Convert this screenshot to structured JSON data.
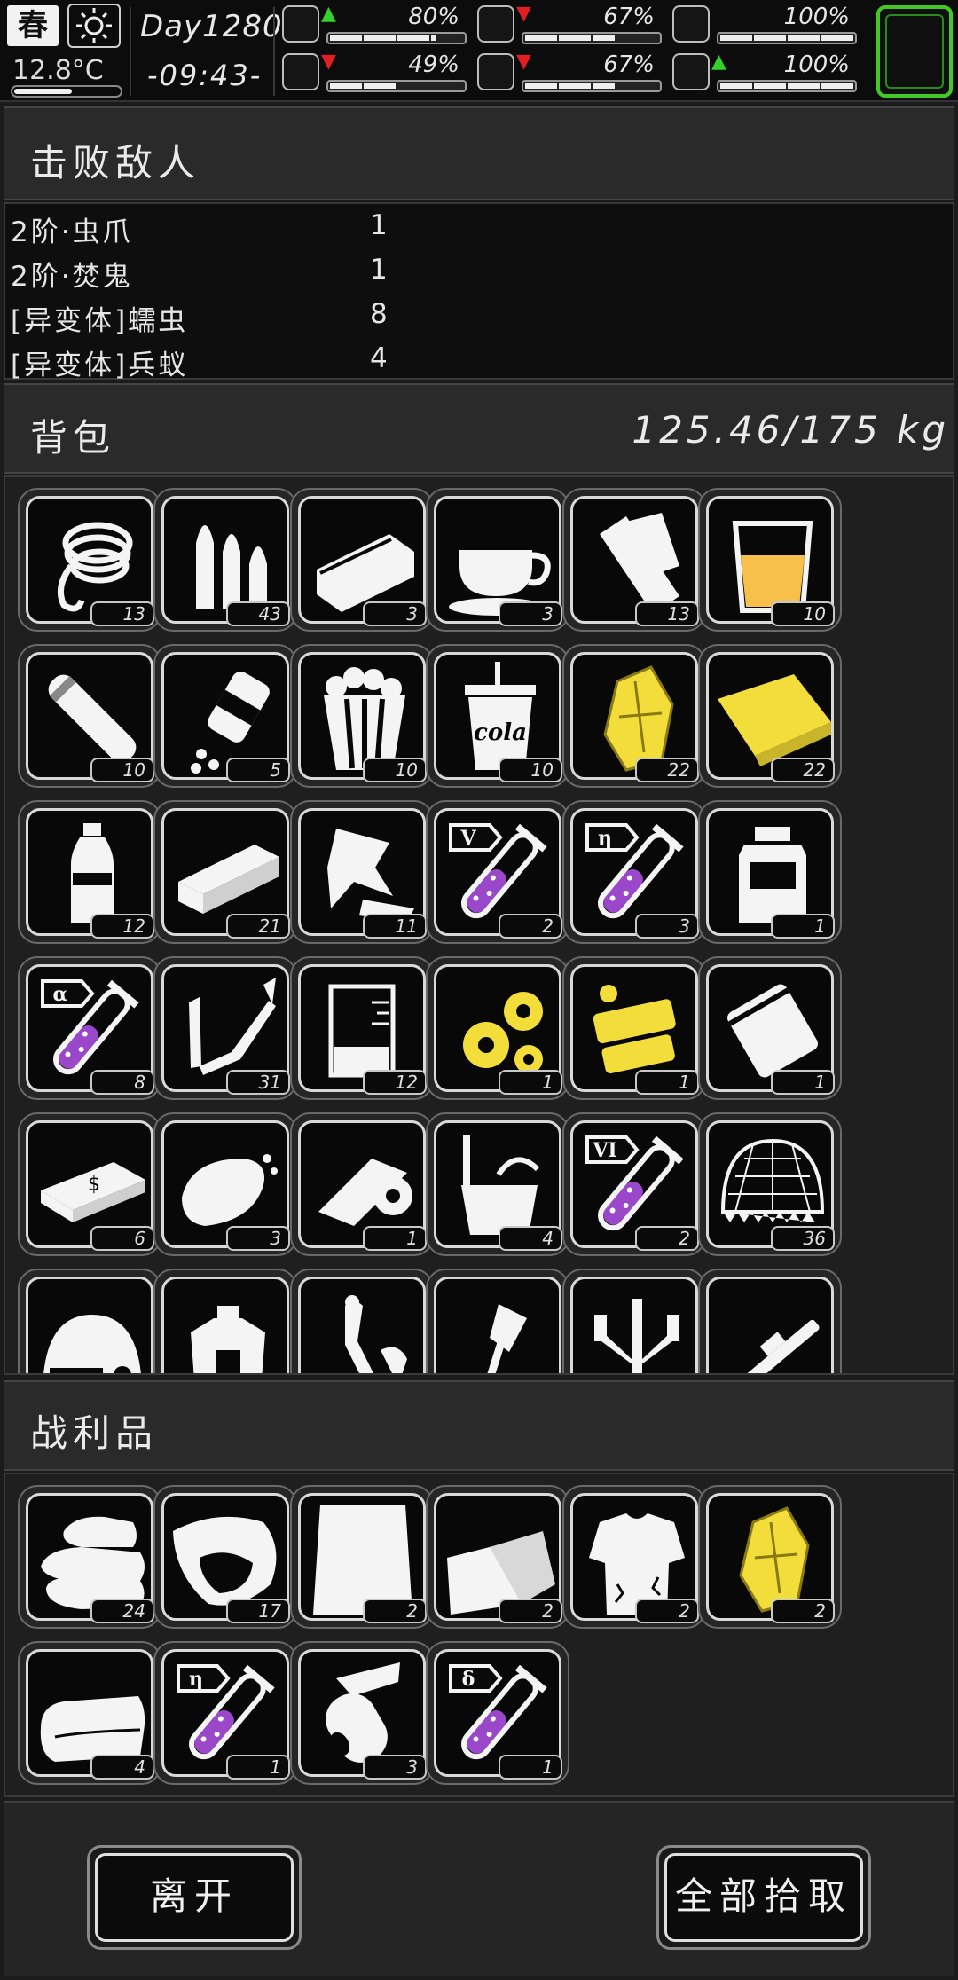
{
  "hud": {
    "season": "春",
    "weather_icon": "sun-icon",
    "temperature": "12.8°C",
    "temperature_level": 0.55,
    "day": "Day1280",
    "time": "-09:43-",
    "stats": [
      {
        "id": "health",
        "icon": "medkit-icon",
        "trend": "up",
        "value": "80%",
        "level": 0.8
      },
      {
        "id": "hunger",
        "icon": "stomach-icon",
        "trend": "down",
        "value": "67%",
        "level": 0.67
      },
      {
        "id": "capsule",
        "icon": "capsule-icon",
        "trend": "",
        "value": "100%",
        "level": 1.0
      },
      {
        "id": "stamina",
        "icon": "boot-icon",
        "trend": "down",
        "value": "49%",
        "level": 0.49
      },
      {
        "id": "thirst",
        "icon": "water-drop-icon",
        "trend": "down",
        "value": "67%",
        "level": 0.67
      },
      {
        "id": "mood",
        "icon": "heart-icon",
        "trend": "up",
        "value": "100%",
        "level": 1.0
      }
    ],
    "map_button_icon": "map-icon"
  },
  "defeated": {
    "title": "击败敌人",
    "enemies": [
      {
        "name": "2阶·虫爪",
        "count": "1"
      },
      {
        "name": "2阶·焚鬼",
        "count": "1"
      },
      {
        "name": "[异变体]蠕虫",
        "count": "8"
      },
      {
        "name": "[异变体]兵蚁",
        "count": "4"
      }
    ]
  },
  "backpack": {
    "title": "背包",
    "weight": "125.46/175 kg",
    "items": [
      {
        "icon": "rope-icon",
        "qty": "13"
      },
      {
        "icon": "bullets-icon",
        "qty": "43"
      },
      {
        "icon": "canned-food-icon",
        "qty": "3"
      },
      {
        "icon": "coffee-cup-icon",
        "qty": "3"
      },
      {
        "icon": "bandage-roll-icon",
        "qty": "13"
      },
      {
        "icon": "juice-glass-icon",
        "qty": "10"
      },
      {
        "icon": "pipe-icon",
        "qty": "10"
      },
      {
        "icon": "pill-bottle-icon",
        "qty": "5"
      },
      {
        "icon": "popcorn-icon",
        "qty": "10"
      },
      {
        "icon": "cola-cup-icon",
        "qty": "10"
      },
      {
        "icon": "gold-ore-icon",
        "qty": "22"
      },
      {
        "icon": "gold-cloth-icon",
        "qty": "22"
      },
      {
        "icon": "water-bottle-icon",
        "qty": "12"
      },
      {
        "icon": "brick-icon",
        "qty": "21"
      },
      {
        "icon": "scrap-parts-icon",
        "qty": "11"
      },
      {
        "icon": "potion-v-icon",
        "qty": "2"
      },
      {
        "icon": "potion-eta-icon",
        "qty": "3"
      },
      {
        "icon": "jar-icon",
        "qty": "1"
      },
      {
        "icon": "potion-alpha-icon",
        "qty": "8"
      },
      {
        "icon": "soldering-iron-icon",
        "qty": "31"
      },
      {
        "icon": "beaker-icon",
        "qty": "12"
      },
      {
        "icon": "gears-icon",
        "qty": "1"
      },
      {
        "icon": "gold-machine-parts-icon",
        "qty": "1"
      },
      {
        "icon": "sealed-bag-icon",
        "qty": "1"
      },
      {
        "icon": "cash-stack-icon",
        "qty": "6"
      },
      {
        "icon": "bread-icon",
        "qty": "3"
      },
      {
        "icon": "tape-roll-icon",
        "qty": "1"
      },
      {
        "icon": "bucket-icon",
        "qty": "4"
      },
      {
        "icon": "potion-vi-icon",
        "qty": "2"
      },
      {
        "icon": "spiked-net-icon",
        "qty": "36"
      },
      {
        "icon": "helmet-icon",
        "qty": ""
      },
      {
        "icon": "armor-icon",
        "qty": ""
      },
      {
        "icon": "creature-icon",
        "qty": ""
      },
      {
        "icon": "axe-icon",
        "qty": ""
      },
      {
        "icon": "tripod-icon",
        "qty": ""
      },
      {
        "icon": "rifle-icon",
        "qty": ""
      }
    ]
  },
  "loot": {
    "title": "战利品",
    "items": [
      {
        "icon": "folded-cloth-icon",
        "qty": "24"
      },
      {
        "icon": "meat-chunk-icon",
        "qty": "17"
      },
      {
        "icon": "white-sheet-icon",
        "qty": "2"
      },
      {
        "icon": "folded-paper-icon",
        "qty": "2"
      },
      {
        "icon": "torn-shirt-icon",
        "qty": "2"
      },
      {
        "icon": "gold-ore-icon",
        "qty": "2"
      },
      {
        "icon": "towel-icon",
        "qty": "4"
      },
      {
        "icon": "potion-eta-icon",
        "qty": "1"
      },
      {
        "icon": "paper-roll-icon",
        "qty": "3"
      },
      {
        "icon": "potion-delta-icon",
        "qty": "1"
      }
    ]
  },
  "actions": {
    "leave": "离开",
    "take_all": "全部拾取"
  },
  "colors": {
    "gold": "#f2dd3a",
    "potion_purple": "#9b47c9",
    "juice": "#f6c04a",
    "arrow_up": "#34d12d",
    "arrow_down": "#e02020",
    "map_frame": "#42c928"
  }
}
